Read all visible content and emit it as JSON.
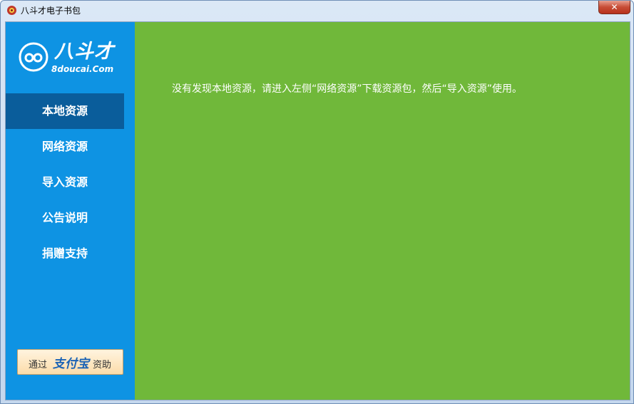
{
  "window": {
    "title": "八斗才电子书包",
    "close_label": "✕"
  },
  "logo": {
    "cn_text": "八斗才",
    "site": "8doucai.Com"
  },
  "sidebar": {
    "items": [
      {
        "label": "本地资源",
        "active": true
      },
      {
        "label": "网络资源",
        "active": false
      },
      {
        "label": "导入资源",
        "active": false
      },
      {
        "label": "公告说明",
        "active": false
      },
      {
        "label": "捐赠支持",
        "active": false
      }
    ],
    "donate": {
      "prefix": "通过",
      "brand": "支付宝",
      "suffix": "资助"
    }
  },
  "main": {
    "message": "没有发现本地资源，请进入左侧“网络资源”下载资源包，然后“导入资源”使用。"
  },
  "colors": {
    "sidebar": "#0e93e3",
    "active_item": "#0a5d9b",
    "content": "#70b83a"
  }
}
